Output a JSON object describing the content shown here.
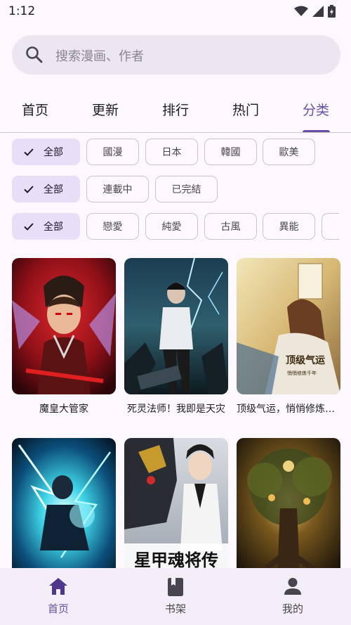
{
  "status_bar": {
    "time": "1:12"
  },
  "search": {
    "placeholder": "搜索漫画、作者"
  },
  "tabs": [
    {
      "label": "首页",
      "active": false
    },
    {
      "label": "更新",
      "active": false
    },
    {
      "label": "排行",
      "active": false
    },
    {
      "label": "热门",
      "active": false
    },
    {
      "label": "分类",
      "active": true
    }
  ],
  "filters": {
    "region": {
      "selected": "全部",
      "options": [
        "國漫",
        "日本",
        "韓國",
        "歐美"
      ]
    },
    "status": {
      "selected": "全部",
      "options": [
        "連載中",
        "已完結"
      ]
    },
    "genre": {
      "selected": "全部",
      "options": [
        "戀愛",
        "純愛",
        "古風",
        "異能"
      ]
    }
  },
  "comics": [
    {
      "title": "魔皇大管家"
    },
    {
      "title": "死灵法师！我即是天灾"
    },
    {
      "title": "顶级气运，悄悄修炼千年"
    },
    {
      "title": ""
    },
    {
      "title": ""
    },
    {
      "title": ""
    }
  ],
  "cover_art_text": {
    "xinghun": "星甲魂将传",
    "dingji": "顶级气运",
    "dingji_sub": "悄悄修炼千年"
  },
  "bottom_nav": [
    {
      "label": "首页",
      "icon": "home-icon",
      "active": true
    },
    {
      "label": "书架",
      "icon": "bookshelf-icon",
      "active": false
    },
    {
      "label": "我的",
      "icon": "profile-icon",
      "active": false
    }
  ],
  "colors": {
    "accent": "#6750A4",
    "chip_selected": "#E8DEF8",
    "background": "#FDF7FF",
    "nav_bg": "#F3EDF7"
  }
}
